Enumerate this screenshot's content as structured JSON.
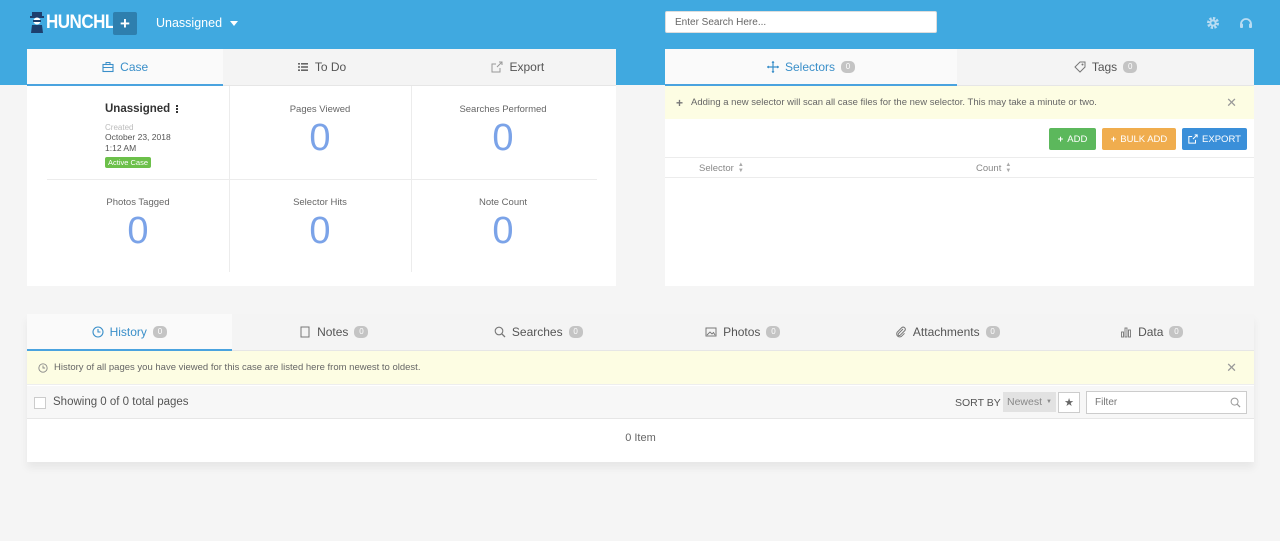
{
  "header": {
    "logo_text": "HUNCHLY",
    "add_case_label": "+",
    "case_name": "Unassigned",
    "search_placeholder": "Enter Search Here..."
  },
  "case_panel": {
    "tabs": [
      {
        "label": "Case",
        "icon": "briefcase-icon"
      },
      {
        "label": "To Do",
        "icon": "list-icon"
      },
      {
        "label": "Export",
        "icon": "export-icon"
      }
    ],
    "case_info": {
      "name": "Unassigned",
      "created_label": "Created",
      "date": "October 23, 2018",
      "time": "1:12 AM",
      "status": "Active Case"
    },
    "stats": [
      {
        "label": "Pages Viewed",
        "value": "0"
      },
      {
        "label": "Searches Performed",
        "value": "0"
      },
      {
        "label": "Photos Tagged",
        "value": "0"
      },
      {
        "label": "Selector Hits",
        "value": "0"
      },
      {
        "label": "Note Count",
        "value": "0"
      }
    ]
  },
  "selectors_panel": {
    "tabs": [
      {
        "label": "Selectors",
        "count": "0",
        "icon": "crosshair-icon"
      },
      {
        "label": "Tags",
        "count": "0",
        "icon": "tag-icon"
      }
    ],
    "notice": "Adding a new selector will scan all case files for the new selector. This may take a minute or two.",
    "buttons": {
      "add": "ADD",
      "bulk_add": "BULK ADD",
      "export": "EXPORT"
    },
    "columns": [
      "Selector",
      "Count"
    ]
  },
  "history_panel": {
    "tabs": [
      {
        "label": "History",
        "count": "0",
        "icon": "clock-icon"
      },
      {
        "label": "Notes",
        "count": "0",
        "icon": "note-icon"
      },
      {
        "label": "Searches",
        "count": "0",
        "icon": "search-icon"
      },
      {
        "label": "Photos",
        "count": "0",
        "icon": "image-icon"
      },
      {
        "label": "Attachments",
        "count": "0",
        "icon": "paperclip-icon"
      },
      {
        "label": "Data",
        "count": "0",
        "icon": "bar-chart-icon"
      }
    ],
    "notice": "History of all pages you have viewed for this case are listed here from newest to oldest.",
    "showing": "Showing 0 of 0 total pages",
    "sort_by_label": "SORT BY",
    "sort_value": "Newest",
    "filter_placeholder": "Filter",
    "empty_text": "0 Item"
  },
  "colors": {
    "header_bg": "#40a9e0",
    "accent": "#3a8fc9",
    "add_green": "#5cb85c",
    "bulk_orange": "#f0ad4e",
    "export_blue": "#3a8fd9",
    "stat_number": "#7ba3e8"
  }
}
